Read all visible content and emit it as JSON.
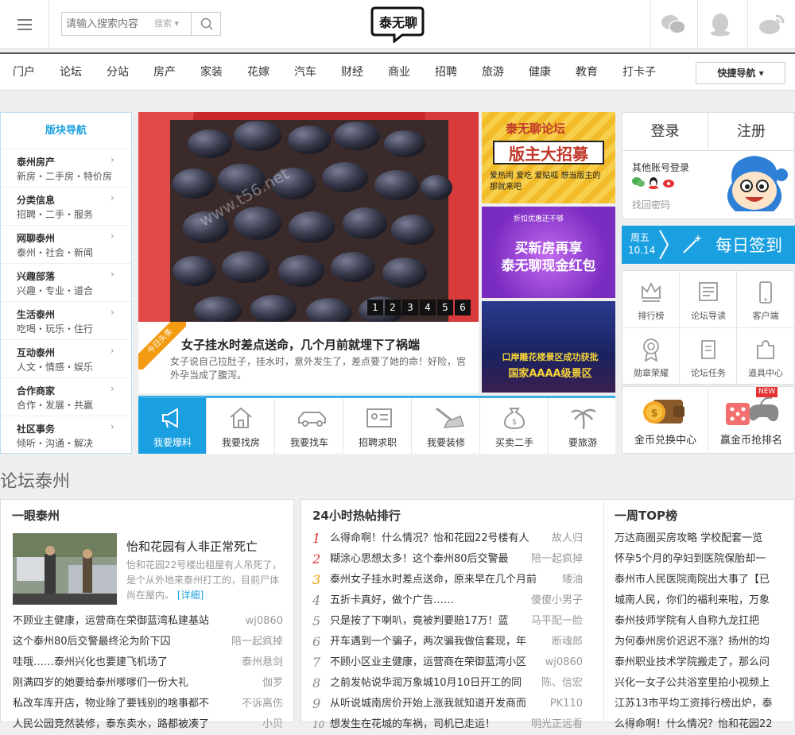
{
  "search": {
    "placeholder": "请输入搜索内容",
    "type_label": "搜索"
  },
  "logo": {
    "text": "泰无聊"
  },
  "nav": {
    "items": [
      "门户",
      "论坛",
      "分站",
      "房产",
      "家装",
      "花嫁",
      "汽车",
      "财经",
      "商业",
      "招聘",
      "旅游",
      "健康",
      "教育",
      "打卡子"
    ],
    "quick": "快捷导航"
  },
  "sidebar": {
    "title": "版块导航",
    "items": [
      {
        "name": "泰州房产",
        "sub": "新房・二手房・特价房"
      },
      {
        "name": "分类信息",
        "sub": "招聘・二手・服务"
      },
      {
        "name": "网聊泰州",
        "sub": "泰州・社会・新闻"
      },
      {
        "name": "兴趣部落",
        "sub": "兴趣・专业・道合"
      },
      {
        "name": "生活泰州",
        "sub": "吃喝・玩乐・住行"
      },
      {
        "name": "互动泰州",
        "sub": "人文・情感・娱乐"
      },
      {
        "name": "合作商家",
        "sub": "合作・发展・共赢"
      },
      {
        "name": "社区事务",
        "sub": "倾听・沟通・解决"
      }
    ]
  },
  "hero": {
    "watermark": "www.t56.net",
    "pages": [
      "1",
      "2",
      "3",
      "4",
      "5",
      "6"
    ],
    "badge": "今日头条",
    "headline": "女子挂水时差点送命，几个月前就埋下了祸端",
    "desc": "女子说自己拉肚子，挂水时，意外发生了，差点要了她的命！好险，宫外孕当成了腹泻。"
  },
  "ads": [
    {
      "line1": "泰无聊论坛",
      "line2": "版主大招募",
      "line3": "爱热闹 爱吃 爱贴呱 想当版主的 那就来吧"
    },
    {
      "line0": "折扣优惠还不够",
      "line1": "买新房再享",
      "line2": "泰无聊现金红包"
    },
    {
      "line1": "口岸雕花楼景区成功获批",
      "line2": "国家AAAA级景区"
    }
  ],
  "services": [
    "我要爆料",
    "我要找房",
    "我要找车",
    "招聘求职",
    "我要装修",
    "买卖二手",
    "要旅游"
  ],
  "login": {
    "login": "登录",
    "register": "注册",
    "other": "其他账号登录",
    "forgot": "找回密码"
  },
  "signin": {
    "weekday": "周五",
    "date": "10.14",
    "label": "每日签到"
  },
  "grid": [
    "排行榜",
    "论坛导读",
    "客户端",
    "勋章荣耀",
    "论坛任务",
    "道具中心"
  ],
  "coins": [
    {
      "label": "金币兑换中心"
    },
    {
      "label": "赢金币抢排名",
      "badge": "NEW"
    }
  ],
  "section_title": "论坛泰州",
  "panel1": {
    "title": "一眼泰州",
    "feature_title": "怡和花园有人非正常死亡",
    "feature_desc": "怡和花园22号楼出租屋有人吊死了，是个从外地来泰州打工的，目前尸体尚在屋内。",
    "more": "[详细]",
    "rows": [
      {
        "t": "不顾业主健康，运营商在荣御蓝湾私建基站",
        "a": "wj0860"
      },
      {
        "t": "这个泰州80后交警最终沦为阶下囚",
        "a": "陪一起疯掉"
      },
      {
        "t": "哇哦……泰州兴化也要建飞机场了",
        "a": "泰州悬剑"
      },
      {
        "t": "刚满四岁的她要给泰州嗲嗲们一份大礼",
        "a": "伽罗"
      },
      {
        "t": "私改车库开店，物业除了要钱别的啥事都不",
        "a": "不诉离伤"
      },
      {
        "t": "人民公园竞然装修，泰东卖水，路都被凑了",
        "a": "小贝"
      }
    ]
  },
  "panel2": {
    "title": "24小时热帖排行",
    "rows": [
      {
        "t": "么得命啊！什么情况？怡和花园22号楼有人",
        "a": "故人归"
      },
      {
        "t": "糊涂心思想太多！这个泰州80后交警最",
        "a": "陪一起疯掉"
      },
      {
        "t": "泰州女子挂水时差点送命，原来早在几个月前",
        "a": "矮油"
      },
      {
        "t": "五折卡真好，做个广告……",
        "a": "傻傻小男子"
      },
      {
        "t": "只是按了下喇叭，竟被判要赔17万！蓝",
        "a": "马平配一脸"
      },
      {
        "t": "开车遇到一个骗子，两次骗我做信套现，年",
        "a": "断魂郎"
      },
      {
        "t": "不顾小区业主健康，运营商在荣御蓝湾小区",
        "a": "wj0860"
      },
      {
        "t": "之前发帖说华润万象城10月10日开工的同",
        "a": "陈、信宏"
      },
      {
        "t": "从听说城南房价开始上涨我就知道开发商而",
        "a": "PK110"
      },
      {
        "t": "想发生在花城的车祸，司机已走运！",
        "a": "明光正远看"
      }
    ]
  },
  "panel3": {
    "title": "一周TOP榜",
    "rows": [
      "万达商圈买房攻略 学校配套一览",
      "怀孕5个月的孕妇到医院保胎却一",
      "泰州市人民医院南院出大事了【已",
      "城南人民，你们的福利来啦，万象",
      "泰州技师学院有人自称九龙扛把",
      "为何泰州房价迟迟不涨？扬州的均",
      "泰州职业技术学院搬走了，那么问",
      "兴化一女子公共浴室里拍小视频上",
      "江苏13市平均工资排行榜出炉，泰",
      "么得命啊！什么情况？怡和花园22"
    ]
  },
  "colors": {
    "accent": "#1aa0e0",
    "ranks": [
      "#e53333",
      "#e53333",
      "#f39800"
    ]
  }
}
